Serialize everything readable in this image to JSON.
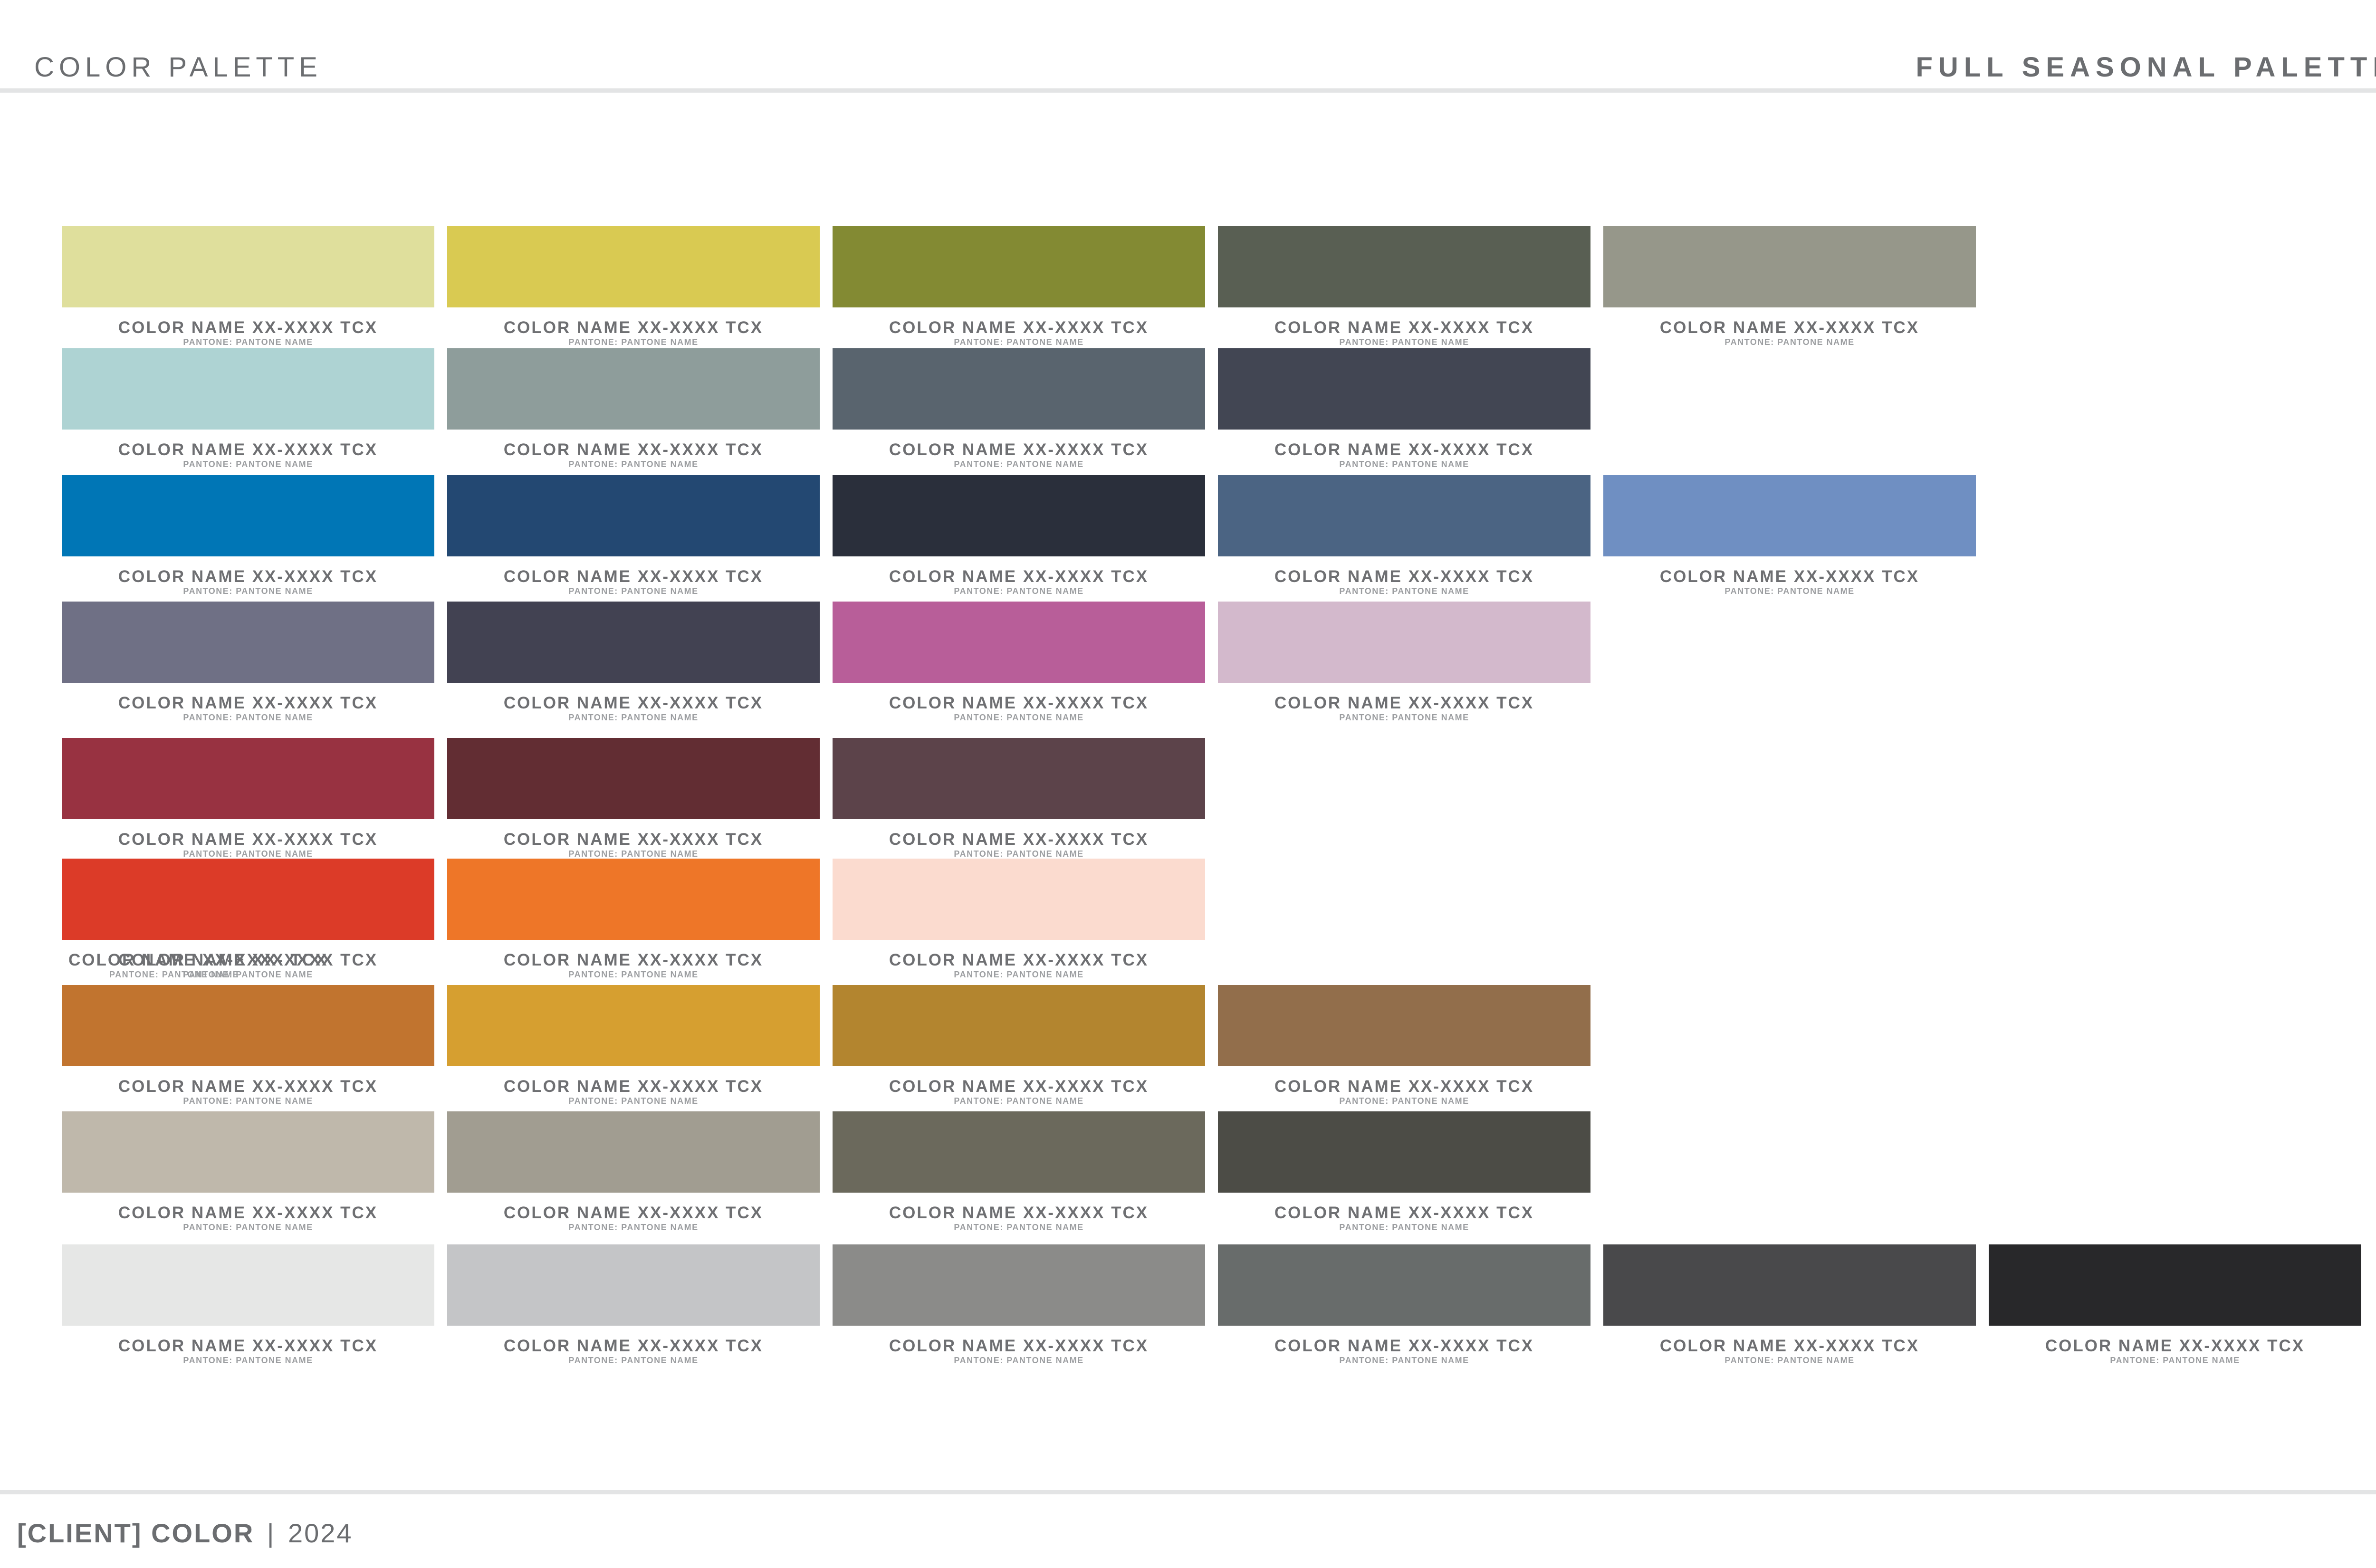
{
  "header": {
    "title": "COLOR PALETTE",
    "section": "FULL SEASONAL PALETTE"
  },
  "footer": {
    "brand": "[CLIENT] COLOR",
    "separator": "|",
    "year": "2024"
  },
  "palette": {
    "rows": [
      [
        {
          "name": "COLOR NAME XX-XXXX TCX",
          "pantone": "PANTONE: PANTONE NAME",
          "color": "#dfdf9c"
        },
        {
          "name": "COLOR NAME XX-XXXX TCX",
          "pantone": "PANTONE: PANTONE NAME",
          "color": "#d9ca52"
        },
        {
          "name": "COLOR NAME XX-XXXX TCX",
          "pantone": "PANTONE: PANTONE NAME",
          "color": "#838a33"
        },
        {
          "name": "COLOR NAME XX-XXXX TCX",
          "pantone": "PANTONE: PANTONE NAME",
          "color": "#595f53"
        },
        {
          "name": "COLOR NAME XX-XXXX TCX",
          "pantone": "PANTONE: PANTONE NAME",
          "color": "#96978a"
        }
      ],
      [
        {
          "name": "COLOR NAME XX-XXXX TCX",
          "pantone": "PANTONE: PANTONE NAME",
          "color": "#aed3d3"
        },
        {
          "name": "COLOR NAME XX-XXXX TCX",
          "pantone": "PANTONE: PANTONE NAME",
          "color": "#8e9d9b"
        },
        {
          "name": "COLOR NAME XX-XXXX TCX",
          "pantone": "PANTONE: PANTONE NAME",
          "color": "#59646e"
        },
        {
          "name": "COLOR NAME XX-XXXX TCX",
          "pantone": "PANTONE: PANTONE NAME",
          "color": "#424653"
        }
      ],
      [
        {
          "name": "COLOR NAME XX-XXXX TCX",
          "pantone": "PANTONE: PANTONE NAME",
          "color": "#0076b6"
        },
        {
          "name": "COLOR NAME XX-XXXX TCX",
          "pantone": "PANTONE: PANTONE NAME",
          "color": "#234872"
        },
        {
          "name": "COLOR NAME XX-XXXX TCX",
          "pantone": "PANTONE: PANTONE NAME",
          "color": "#2a2f3b"
        },
        {
          "name": "COLOR NAME XX-XXXX TCX",
          "pantone": "PANTONE: PANTONE NAME",
          "color": "#4b6483"
        },
        {
          "name": "COLOR NAME XX-XXXX TCX",
          "pantone": "PANTONE: PANTONE NAME",
          "color": "#6f8fc2"
        }
      ],
      [
        {
          "name": "COLOR NAME XX-XXXX TCX",
          "pantone": "PANTONE: PANTONE NAME",
          "color": "#6f7085"
        },
        {
          "name": "COLOR NAME XX-XXXX TCX",
          "pantone": "PANTONE: PANTONE NAME",
          "color": "#424252"
        },
        {
          "name": "COLOR NAME XX-XXXX TCX",
          "pantone": "PANTONE: PANTONE NAME",
          "color": "#b85e99"
        },
        {
          "name": "COLOR NAME XX-XXXX TCX",
          "pantone": "PANTONE: PANTONE NAME",
          "color": "#d3b9cc"
        }
      ],
      [
        {
          "name": "COLOR NAME XX-XXXX TCX",
          "pantone": "PANTONE: PANTONE NAME",
          "color": "#983241"
        },
        {
          "name": "COLOR NAME XX-XXXX TCX",
          "pantone": "PANTONE: PANTONE NAME",
          "color": "#622d33"
        },
        {
          "name": "COLOR NAME XX-XXXX TCX",
          "pantone": "PANTONE: PANTONE NAME",
          "color": "#5c434a"
        }
      ],
      [
        {
          "name": "COLOR NAME XX-XXXX TCX",
          "pantone": "PANTONE: PANTONE NAME",
          "color": "#dc3b28"
        },
        {
          "name": "COLOR NAME XX-XXXX TCX",
          "pantone": "PANTONE: PANTONE NAME",
          "color": "#ee7628"
        },
        {
          "name": "COLOR NAME XX-XXXX TCX",
          "pantone": "PANTONE: PANTONE NAME",
          "color": "#fbdbcf"
        }
      ],
      [
        {
          "name": "COLOR NAME XX-XXXX TCX",
          "pantone": "PANTONE: PANTONE NAME",
          "color": "#c1742f"
        },
        {
          "name": "COLOR NAME XX-XXXX TCX",
          "pantone": "PANTONE: PANTONE NAME",
          "color": "#d69f30"
        },
        {
          "name": "COLOR NAME XX-XXXX TCX",
          "pantone": "PANTONE: PANTONE NAME",
          "color": "#b3852f"
        },
        {
          "name": "COLOR NAME XX-XXXX TCX",
          "pantone": "PANTONE: PANTONE NAME",
          "color": "#926e4b"
        }
      ],
      [
        {
          "name": "COLOR NAME XX-XXXX TCX",
          "pantone": "PANTONE: PANTONE NAME",
          "color": "#bfb8ab"
        },
        {
          "name": "COLOR NAME XX-XXXX TCX",
          "pantone": "PANTONE: PANTONE NAME",
          "color": "#a19d91"
        },
        {
          "name": "COLOR NAME XX-XXXX TCX",
          "pantone": "PANTONE: PANTONE NAME",
          "color": "#6b695c"
        },
        {
          "name": "COLOR NAME XX-XXXX TCX",
          "pantone": "PANTONE: PANTONE NAME",
          "color": "#4c4c46"
        }
      ],
      [
        {
          "name": "COLOR NAME XX-XXXX TCX",
          "pantone": "PANTONE: PANTONE NAME",
          "color": "#e6e7e6"
        },
        {
          "name": "COLOR NAME XX-XXXX TCX",
          "pantone": "PANTONE: PANTONE NAME",
          "color": "#c4c5c7"
        },
        {
          "name": "COLOR NAME XX-XXXX TCX",
          "pantone": "PANTONE: PANTONE NAME",
          "color": "#8b8b89"
        },
        {
          "name": "COLOR NAME XX-XXXX TCX",
          "pantone": "PANTONE: PANTONE NAME",
          "color": "#686c6b"
        },
        {
          "name": "COLOR NAME XX-XXXX TCX",
          "pantone": "PANTONE: PANTONE NAME",
          "color": "#49494b"
        },
        {
          "name": "COLOR NAME XX-XXXX TCX",
          "pantone": "PANTONE: PANTONE NAME",
          "color": "#28282a"
        }
      ]
    ],
    "stray_label": {
      "name": "COLOR NAME XX-XXXX TCX",
      "pantone": "PANTONE: PANTONE NAME"
    }
  }
}
